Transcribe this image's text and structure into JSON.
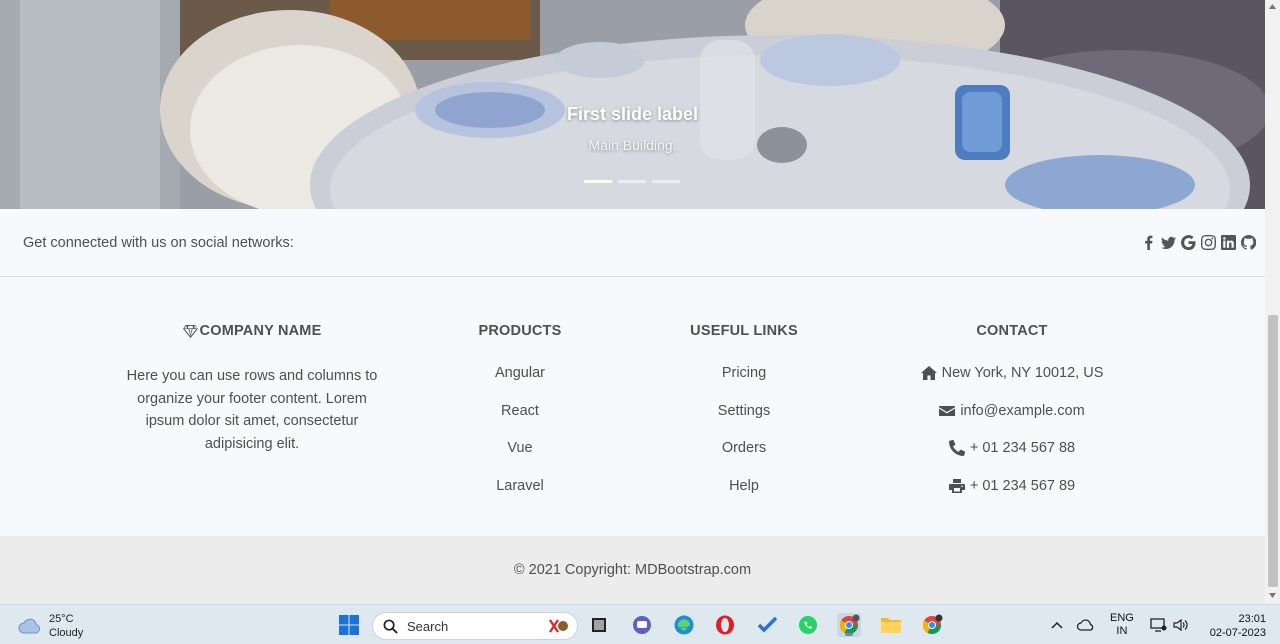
{
  "carousel": {
    "slide_label": "First slide label",
    "slide_caption": "Main Building.",
    "indicator_count": 3,
    "active_indicator": 0
  },
  "social": {
    "text": "Get connected with us on social networks:",
    "icons": [
      "facebook-icon",
      "twitter-icon",
      "google-icon",
      "instagram-icon",
      "linkedin-icon",
      "github-icon"
    ]
  },
  "footer": {
    "company": {
      "title": "COMPANY NAME",
      "text": "Here you can use rows and columns to organize your footer content. Lorem ipsum dolor sit amet, consectetur adipisicing elit."
    },
    "products": {
      "title": "PRODUCTS",
      "items": [
        "Angular",
        "React",
        "Vue",
        "Laravel"
      ]
    },
    "links": {
      "title": "USEFUL LINKS",
      "items": [
        "Pricing",
        "Settings",
        "Orders",
        "Help"
      ]
    },
    "contact": {
      "title": "CONTACT",
      "address": "New York, NY 10012, US",
      "email": "info@example.com",
      "phone": "+ 01 234 567 88",
      "fax": "+ 01 234 567 89"
    }
  },
  "copyright": "© 2021 Copyright: MDBootstrap.com",
  "taskbar": {
    "weather_temp": "25°C",
    "weather_desc": "Cloudy",
    "search_placeholder": "Search",
    "lang_top": "ENG",
    "lang_bottom": "IN",
    "time": "23:01",
    "date": "02-07-2023"
  },
  "colors": {
    "footer_bg": "#f8f9fa",
    "copyright_bg": "#ececec",
    "text": "#4f4f4f",
    "taskbar_bg": "#dde8ef"
  }
}
